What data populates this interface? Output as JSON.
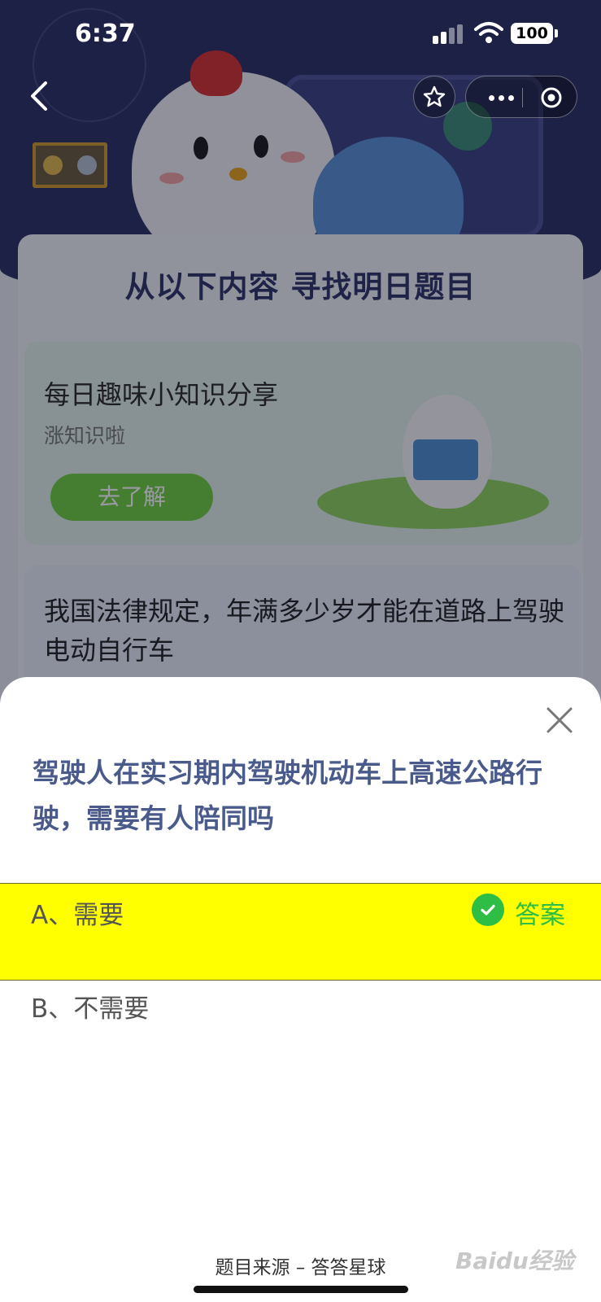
{
  "status_bar": {
    "time": "6:37",
    "battery": "100"
  },
  "background_page": {
    "section_title": "从以下内容  寻找明日题目",
    "share_card": {
      "title": "每日趣味小知识分享",
      "subtitle": "涨知识啦",
      "button": "去了解"
    },
    "question_card": {
      "text": "我国法律规定，年满多少岁才能在道路上驾驶电动自行车"
    }
  },
  "sheet": {
    "question": "驾驶人在实习期内驾驶机动车上高速公路行驶，需要有人陪同吗",
    "options": [
      {
        "label": "A、需要",
        "is_answer": true,
        "answer_tag": "答案"
      },
      {
        "label": "B、不需要",
        "is_answer": false
      }
    ],
    "source": "题目来源 – 答答星球"
  },
  "watermark": "Baidu经验",
  "colors": {
    "highlight": "#ffff00",
    "answer_green": "#2fbe45",
    "question_text": "#4a5a8a"
  }
}
